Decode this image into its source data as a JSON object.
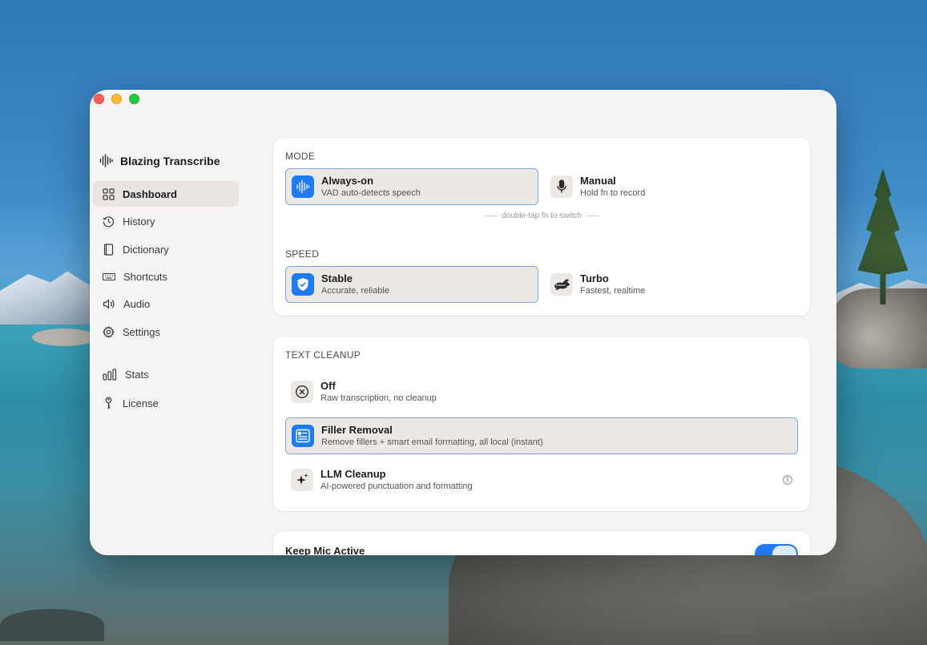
{
  "app": {
    "title": "Blazing Transcribe"
  },
  "sidebar": {
    "items": [
      {
        "label": "Dashboard",
        "icon": "grid-icon"
      },
      {
        "label": "History",
        "icon": "clock-history-icon"
      },
      {
        "label": "Dictionary",
        "icon": "book-icon"
      },
      {
        "label": "Shortcuts",
        "icon": "keyboard-icon"
      },
      {
        "label": "Audio",
        "icon": "speaker-icon"
      },
      {
        "label": "Settings",
        "icon": "gear-icon"
      },
      {
        "label": "Stats",
        "icon": "bar-chart-icon"
      },
      {
        "label": "License",
        "icon": "key-icon"
      }
    ],
    "active": "Dashboard"
  },
  "mode": {
    "label": "MODE",
    "options": [
      {
        "title": "Always-on",
        "subtitle": "VAD auto-detects speech",
        "selected": true
      },
      {
        "title": "Manual",
        "subtitle": "Hold fn to record",
        "selected": false
      }
    ],
    "hint": "double-tap fn to switch"
  },
  "speed": {
    "label": "SPEED",
    "options": [
      {
        "title": "Stable",
        "subtitle": "Accurate, reliable",
        "selected": true
      },
      {
        "title": "Turbo",
        "subtitle": "Fastest, realtime",
        "selected": false
      }
    ]
  },
  "cleanup": {
    "label": "TEXT CLEANUP",
    "options": [
      {
        "title": "Off",
        "subtitle": "Raw transcription, no cleanup",
        "selected": false
      },
      {
        "title": "Filler Removal",
        "subtitle": "Remove fillers + smart email formatting, all local (instant)",
        "selected": true
      },
      {
        "title": "LLM Cleanup",
        "subtitle": "AI-powered punctuation and formatting",
        "selected": false
      }
    ]
  },
  "keep_mic": {
    "label": "Keep Mic Active",
    "enabled": true
  },
  "colors": {
    "accent": "#1f7bf5",
    "window_bg": "#f6f4f2",
    "selected_bg": "#ece8e4",
    "selected_border": "#7aa6e6"
  }
}
